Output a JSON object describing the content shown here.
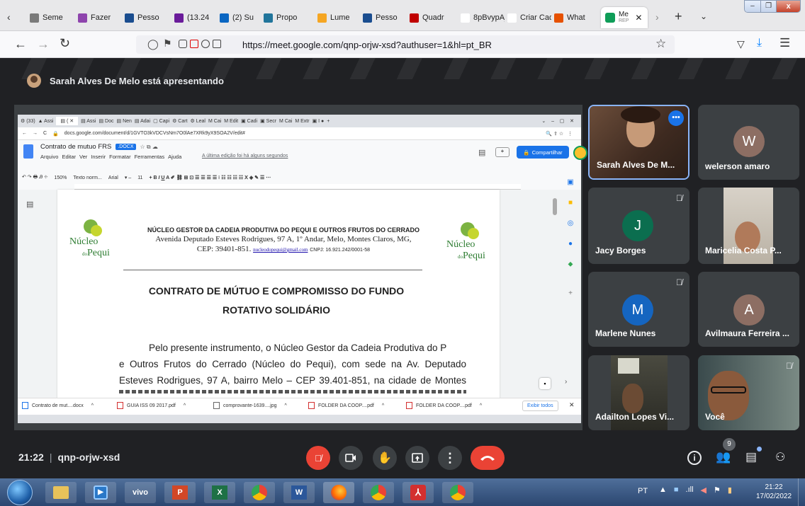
{
  "browser": {
    "tabs": [
      {
        "label": "Seme",
        "color": "#7a7a7a"
      },
      {
        "label": "Fazer",
        "color": "#8e44ad"
      },
      {
        "label": "Pesso",
        "color": "#1a4d8f"
      },
      {
        "label": "(13.24",
        "color": "#6a1b9a"
      },
      {
        "label": "(2) Su",
        "color": "#0a66c2"
      },
      {
        "label": "Propo",
        "color": "#21759b"
      },
      {
        "label": "Lume",
        "color": "#f5a623"
      },
      {
        "label": "Pesso",
        "color": "#1a4d8f"
      },
      {
        "label": "Quadr",
        "color": "#c00000"
      },
      {
        "label": "8pBvypAj",
        "color": "#ffffff"
      },
      {
        "label": "Criar Cada",
        "color": "#ffffff"
      },
      {
        "label": "What",
        "color": "#e65100"
      }
    ],
    "active_tab": {
      "label": "Me",
      "sublabel": "REP"
    },
    "url": "https://meet.google.com/qnp-orjw-xsd?authuser=1&hl=pt_BR"
  },
  "meet": {
    "presenter_banner": "Sarah Alves De Melo está apresentando",
    "meeting_time": "21:22",
    "meeting_code": "qnp-orjw-xsd",
    "participants_count": "9",
    "participants": [
      {
        "name": "Sarah Alves De M...",
        "type": "video",
        "speaking": true
      },
      {
        "name": "welerson amaro",
        "initial": "W",
        "color": "#8d6e63"
      },
      {
        "name": "Jacy Borges",
        "initial": "J",
        "color": "#0b6e4f",
        "muted": true
      },
      {
        "name": "Maricelia Costa P...",
        "type": "video"
      },
      {
        "name": "Marlene Nunes",
        "initial": "M",
        "color": "#1565c0",
        "muted": true
      },
      {
        "name": "Avilmaura Ferreira ...",
        "initial": "A",
        "color": "#8d6e63"
      },
      {
        "name": "Adailton Lopes Vi...",
        "type": "video"
      },
      {
        "name": "Você",
        "type": "video",
        "muted": true
      }
    ]
  },
  "shared_doc": {
    "chrome_url": "docs.google.com/document/d/1GVTO3kVDCVsNm7O0lAe7XRk9yX9SOA2V/edit#",
    "doc_title": "Contrato de mutuo FRS",
    "doc_badge": ".DOCX",
    "menus": [
      "Arquivo",
      "Editar",
      "Ver",
      "Inserir",
      "Formatar",
      "Ferramentas",
      "Ajuda"
    ],
    "last_edit": "A última edição foi há alguns segundos",
    "share_label": "Compartilhar",
    "zoom": "150%",
    "style": "Texto norm...",
    "font": "Arial",
    "font_size": "11",
    "logo_text": "Núcleo",
    "logo_sub": "do",
    "logo_brand": "Pequi",
    "header_title": "NÚCLEO GESTOR DA CADEIA PRODUTIVA DO PEQUI E OUTROS FRUTOS DO CERRADO",
    "header_addr1": "Avenida Deputado Esteves Rodrigues, 97 A, 1º Andar, Melo, Montes Claros, MG,",
    "header_cep": "CEP: 39401-851.",
    "header_email": "nucleodopequi@gmail.com",
    "header_cnpj": "CNPJ: 16.921.242/0001-58",
    "title1": "CONTRATO DE MÚTUO E COMPROMISSO DO FUNDO",
    "title2": "ROTATIVO SOLIDÁRIO",
    "body_lines": [
      "Pelo presente instrumento, o Núcleo Gestor da Cadeia Produtiva do Pequi",
      "e Outros Frutos do Cerrado (Núcleo do Pequi), com sede na Av. Deputado",
      "Esteves Rodrigues, 97 A, bairro Melo – CEP 39.401-851, na cidade de Montes"
    ],
    "downloads": [
      "Contrato de mut....docx",
      "GUIA ISS 09 2017.pdf",
      "comprovante-1639....jpg",
      "FOLDER DA COOP....pdf",
      "FOLDER DA COOP....pdf"
    ],
    "show_all": "Exibir todos"
  },
  "taskbar": {
    "lang": "PT",
    "time": "21:22",
    "date": "17/02/2022",
    "vivo": "vivo"
  }
}
